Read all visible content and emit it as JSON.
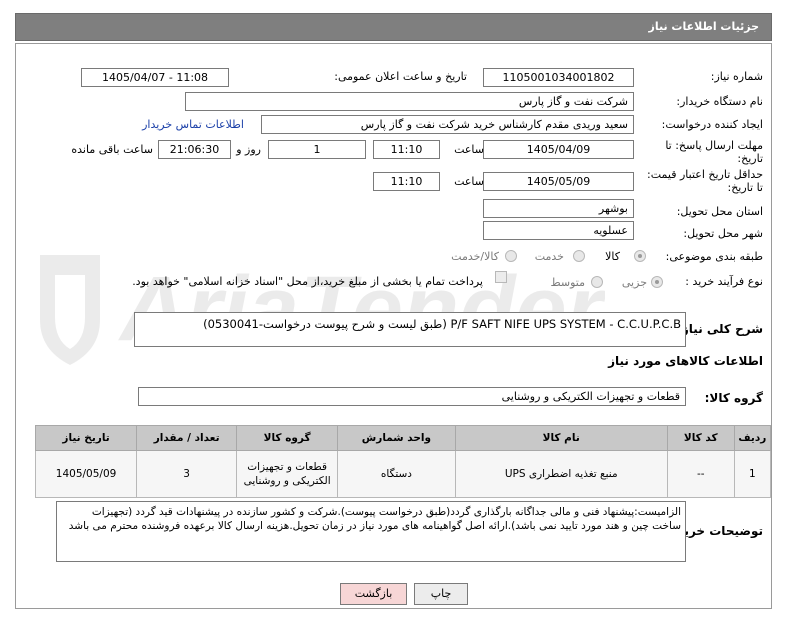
{
  "header": {
    "title": "جزئیات اطلاعات نیاز"
  },
  "form": {
    "need_number": {
      "label": "شماره نیاز:",
      "value": "1105001034001802"
    },
    "announce_datetime": {
      "label": "تاریخ و ساعت اعلان عمومی:",
      "value": "1405/04/07 - 11:08"
    },
    "buyer_org": {
      "label": "نام دستگاه خریدار:",
      "value": "شرکت نفت و گاز پارس"
    },
    "requester": {
      "label": "ایجاد کننده درخواست:",
      "value": "سعید وریدی مقدم کارشناس خرید شرکت نفت و گاز پارس",
      "contact_link": "اطلاعات تماس خریدار"
    },
    "reply_deadline": {
      "label_line1": "مهلت ارسال پاسخ: تا",
      "label_line2": "تاریخ:",
      "date": "1405/04/09",
      "time_label": "ساعت",
      "time": "11:10",
      "days": "1",
      "days_label": "روز و",
      "remaining": "21:06:30",
      "remaining_label": "ساعت باقی مانده"
    },
    "price_validity": {
      "label_line1": "حداقل تاریخ اعتبار قیمت:",
      "label_line2": "تا تاریخ:",
      "date": "1405/05/09",
      "time_label": "ساعت",
      "time": "11:10"
    },
    "province": {
      "label": "استان محل تحویل:",
      "value": "بوشهر"
    },
    "city": {
      "label": "شهر محل تحویل:",
      "value": "عسلویه"
    },
    "category": {
      "label": "طبقه بندی موضوعی:",
      "options": [
        "کالا",
        "خدمت",
        "کالا/خدمت"
      ]
    },
    "process": {
      "label": "نوع فرآیند خرید :",
      "options": [
        "جزیی",
        "متوسط"
      ],
      "note": "پرداخت تمام یا بخشی از مبلغ خرید،از محل \"اسناد خزانه اسلامی\" خواهد بود."
    }
  },
  "description": {
    "label": "شرح کلی نیاز:",
    "value": "P/F SAFT NIFE UPS SYSTEM - C.C.U.P.C.B (طبق لیست و شرح پیوست درخواست-0530041)"
  },
  "goods_section": {
    "title": "اطلاعات کالاهای مورد نیاز"
  },
  "goods_group": {
    "label": "گروه کالا:",
    "value": "قطعات و تجهیزات الکتریکی و روشنایی"
  },
  "table": {
    "headers": [
      "ردیف",
      "کد کالا",
      "نام کالا",
      "واحد شمارش",
      "گروه کالا",
      "تعداد / مقدار",
      "تاریخ نیاز"
    ],
    "rows": [
      {
        "row": "1",
        "code": "--",
        "name": "منبع تغذیه اضطراری UPS",
        "unit": "دستگاه",
        "group": "قطعات و تجهیزات الکتریکی و روشنایی",
        "qty": "3",
        "date": "1405/05/09"
      }
    ]
  },
  "buyer_notes": {
    "label": "توضیحات خریدار:",
    "value": "الزامیست:پیشنهاد فنی و مالی  جداگانه بارگذاری گردد(طبق درخواست پیوست).شرکت و کشور سازنده در پیشنهادات قید گردد (تجهیزات ساخت چین و هند مورد تایید نمی باشد).ارائه اصل گواهینامه های مورد نیاز در زمان تحویل.هزینه ارسال کالا برعهده فروشنده محترم می باشد"
  },
  "buttons": {
    "print": "چاپ",
    "back": "بازگشت"
  },
  "watermark": {
    "text": "AriaTender.net"
  },
  "colors": {
    "header_bg": "#7f7f7f",
    "link": "#1a3fa8",
    "back_button_bg": "#f7d6d6",
    "print_button_bg": "#ececec",
    "table_header_bg": "#c8c8c8"
  }
}
